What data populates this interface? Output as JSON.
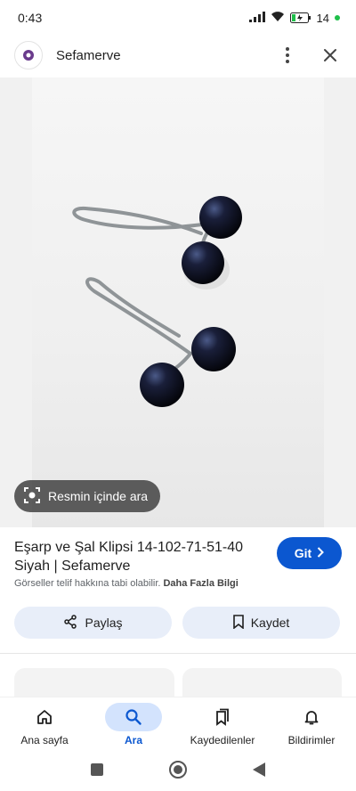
{
  "status_bar": {
    "time": "0:43",
    "battery": "14"
  },
  "header": {
    "site_name": "Sefamerve"
  },
  "image": {
    "lens_label": "Resmin içinde ara"
  },
  "result": {
    "title": "Eşarp ve Şal Klipsi 14-102-71-51-40 Siyah | Sefamerve",
    "go_label": "Git",
    "copyright_notice": "Görseller telif hakkına tabi olabilir.",
    "more_info": "Daha Fazla Bilgi"
  },
  "actions": {
    "share_label": "Paylaş",
    "save_label": "Kaydet"
  },
  "bottom_nav": {
    "items": [
      {
        "label": "Ana sayfa",
        "icon": "home-icon"
      },
      {
        "label": "Ara",
        "icon": "search-icon",
        "active": true
      },
      {
        "label": "Kaydedilenler",
        "icon": "saved-icon"
      },
      {
        "label": "Bildirimler",
        "icon": "bell-icon"
      }
    ]
  },
  "colors": {
    "accent": "#0b57d0",
    "pill_bg": "#e8eef9",
    "active_nav_bg": "#d3e3fd"
  }
}
